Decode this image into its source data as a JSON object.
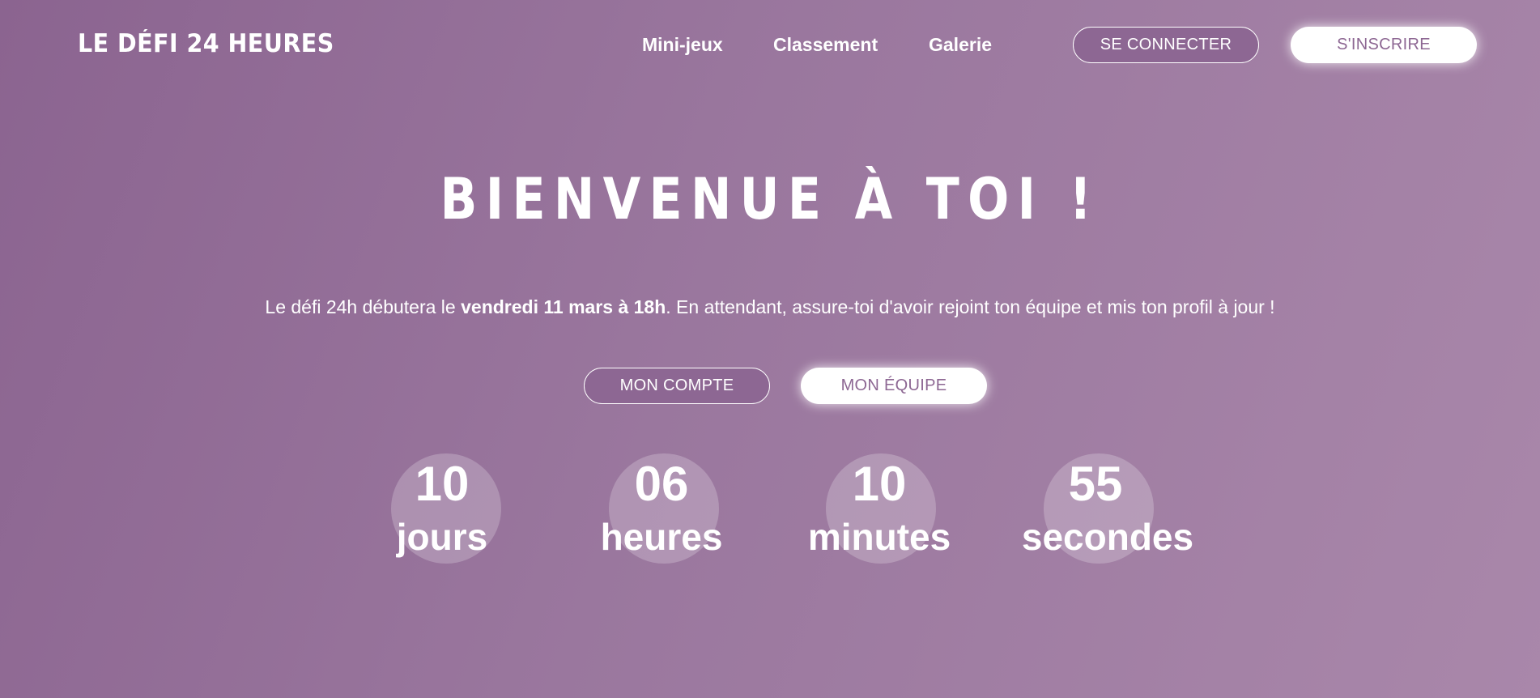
{
  "header": {
    "logo": "LE DÉFI 24 HEURES",
    "nav": [
      "Mini-jeux",
      "Classement",
      "Galerie"
    ],
    "login_label": "SE CONNECTER",
    "signup_label": "S'INSCRIRE"
  },
  "hero": {
    "title": "BIENVENUE À TOI !",
    "intro_before": "Le défi 24h débutera le ",
    "intro_bold": "vendredi 11 mars à 18h",
    "intro_after": ". En attendant, assure-toi d'avoir rejoint ton équipe et mis ton profil à jour !",
    "account_label": "MON COMPTE",
    "team_label": "MON ÉQUIPE"
  },
  "countdown": {
    "days": {
      "value": "10",
      "unit": "jours"
    },
    "hours": {
      "value": "06",
      "unit": "heures"
    },
    "minutes": {
      "value": "10",
      "unit": "minutes"
    },
    "seconds": {
      "value": "55",
      "unit": "secondes"
    }
  },
  "colors": {
    "accent": "#8d6793",
    "background_start": "#8b6490",
    "background_end": "#a987aa",
    "text": "#ffffff"
  }
}
